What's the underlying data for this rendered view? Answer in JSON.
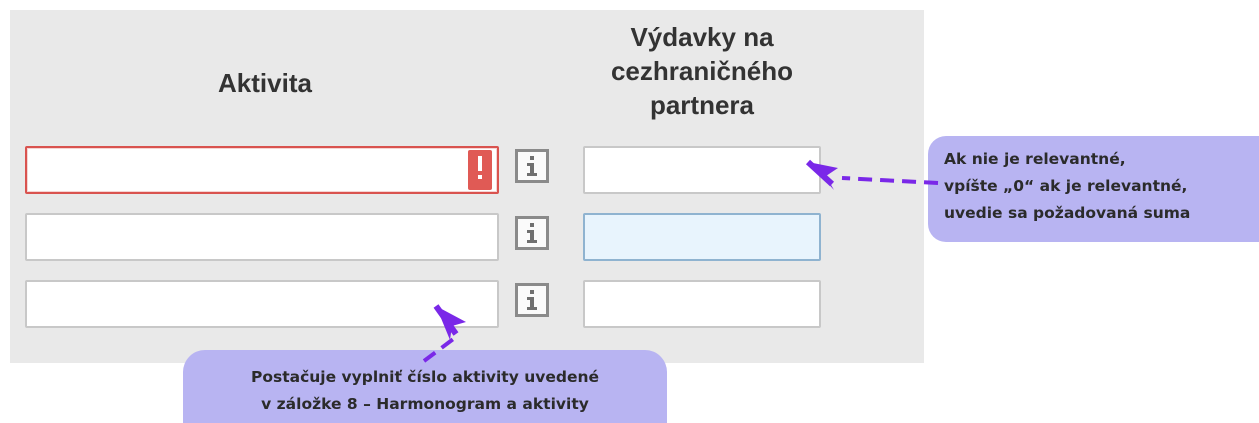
{
  "form": {
    "headers": {
      "activity": "Aktivita",
      "expenses": "Výdavky na\ncezhraničného\npartnera"
    },
    "rows": [
      {
        "activity_value": "",
        "expense_value": "",
        "activity_state": "error",
        "expense_state": "normal"
      },
      {
        "activity_value": "",
        "expense_value": "",
        "activity_state": "normal",
        "expense_state": "focused"
      },
      {
        "activity_value": "",
        "expense_value": "",
        "activity_state": "normal",
        "expense_state": "normal"
      }
    ],
    "error_badge_symbol": "!",
    "info_icon_symbol": "i"
  },
  "callouts": {
    "expenses_hint": [
      "Ak nie je relevantné,",
      "vpíšte „0“ ak je relevantné,",
      "uvedie sa požadovaná suma"
    ],
    "activity_hint": [
      "Postačuje vyplniť číslo aktivity uvedené",
      "v záložke 8 – Harmonogram a aktivity"
    ]
  },
  "colors": {
    "panel_background": "#e9e9e9",
    "error_border": "#d9534f",
    "error_badge": "#e05a55",
    "focused_field_background": "#e8f4fd",
    "callout_background": "#b8b4f2",
    "arrow": "#7a28e8"
  },
  "icons": {
    "error": "exclamation-icon",
    "info": "info-icon",
    "pointer_arrow": "arrow-icon"
  }
}
